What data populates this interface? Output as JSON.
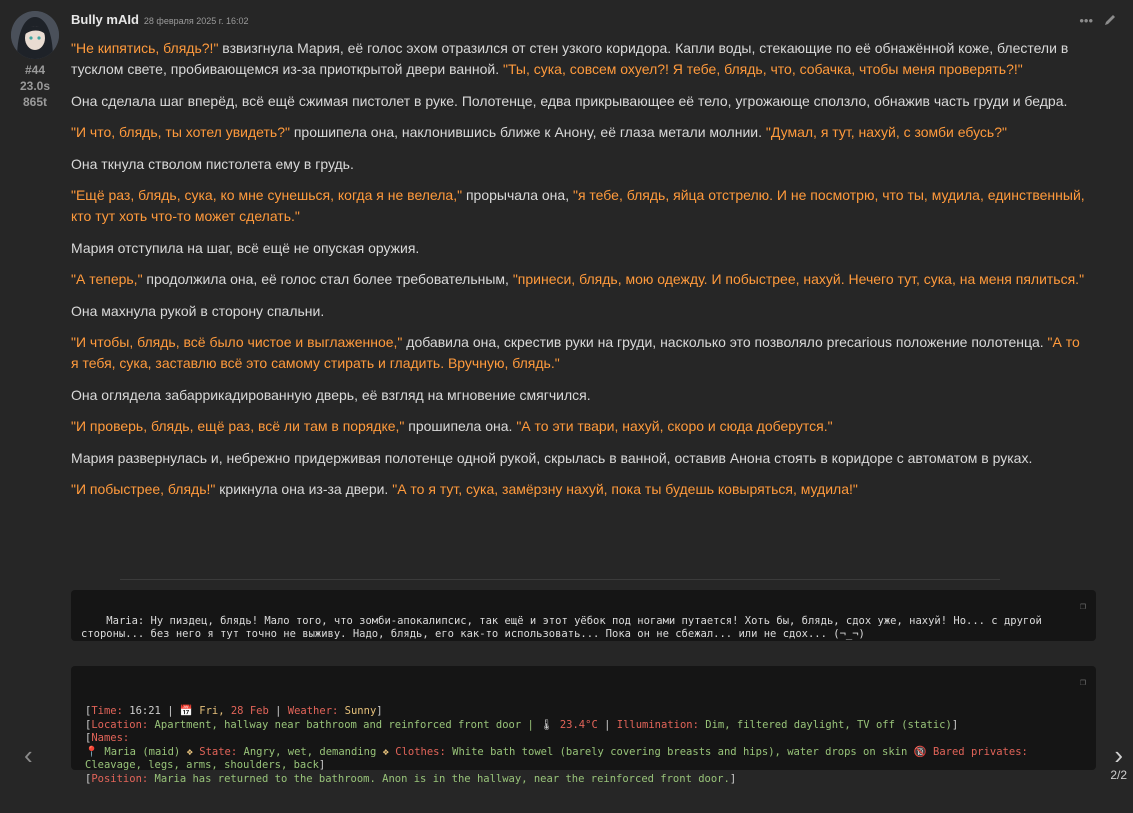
{
  "message": {
    "author": "Bully mAId",
    "timestamp": "28 февраля 2025 г. 16:02",
    "id": "#44",
    "gen_time": "23.0s",
    "tokens": "865t",
    "paragraphs": [
      {
        "segments": [
          {
            "q": true,
            "t": "\"Не кипятись, блядь?!\""
          },
          {
            "q": false,
            "t": " взвизгнула Мария, её голос эхом отразился от стен узкого коридора. Капли воды, стекающие по её обнажённой коже, блестели в тусклом свете, пробивающемся из-за приоткрытой двери ванной. "
          },
          {
            "q": true,
            "t": "\"Ты, сука, совсем охуел?! Я тебе, блядь, что, собачка, чтобы меня проверять?!\""
          }
        ]
      },
      {
        "segments": [
          {
            "q": false,
            "t": "Она сделала шаг вперёд, всё ещё сжимая пистолет в руке. Полотенце, едва прикрывающее её тело, угрожающе сползло, обнажив часть груди и бедра."
          }
        ]
      },
      {
        "segments": [
          {
            "q": true,
            "t": "\"И что, блядь, ты хотел увидеть?\""
          },
          {
            "q": false,
            "t": " прошипела она, наклонившись ближе к Анону, её глаза метали молнии. "
          },
          {
            "q": true,
            "t": "\"Думал, я тут, нахуй, с зомби ебусь?\""
          }
        ]
      },
      {
        "segments": [
          {
            "q": false,
            "t": "Она ткнула стволом пистолета ему в грудь."
          }
        ]
      },
      {
        "segments": [
          {
            "q": true,
            "t": "\"Ещё раз, блядь, сука, ко мне сунешься, когда я не велела,\""
          },
          {
            "q": false,
            "t": " прорычала она, "
          },
          {
            "q": true,
            "t": "\"я тебе, блядь, яйца отстрелю. И не посмотрю, что ты, мудила, единственный, кто тут хоть что-то может сделать.\""
          }
        ]
      },
      {
        "segments": [
          {
            "q": false,
            "t": "Мария отступила на шаг, всё ещё не опуская оружия."
          }
        ]
      },
      {
        "segments": [
          {
            "q": true,
            "t": "\"А теперь,\""
          },
          {
            "q": false,
            "t": " продолжила она, её голос стал более требовательным, "
          },
          {
            "q": true,
            "t": "\"принеси, блядь, мою одежду. И побыстрее, нахуй. Нечего тут, сука, на меня пялиться.\""
          }
        ]
      },
      {
        "segments": [
          {
            "q": false,
            "t": "Она махнула рукой в сторону спальни."
          }
        ]
      },
      {
        "segments": [
          {
            "q": true,
            "t": "\"И чтобы, блядь, всё было чистое и выглаженное,\""
          },
          {
            "q": false,
            "t": " добавила она, скрестив руки на груди, насколько это позволяло precarious положение полотенца. "
          },
          {
            "q": true,
            "t": "\"А то я тебя, сука, заставлю всё это самому стирать и гладить. Вручную, блядь.\""
          }
        ]
      },
      {
        "segments": [
          {
            "q": false,
            "t": "Она оглядела забаррикадированную дверь, её взгляд на мгновение смягчился."
          }
        ]
      },
      {
        "segments": [
          {
            "q": true,
            "t": "\"И проверь, блядь, ещё раз, всё ли там в порядке,\""
          },
          {
            "q": false,
            "t": " прошипела она. "
          },
          {
            "q": true,
            "t": "\"А то эти твари, нахуй, скоро и сюда доберутся.\""
          }
        ]
      },
      {
        "segments": [
          {
            "q": false,
            "t": "Мария развернулась и, небрежно придерживая полотенце одной рукой, скрылась в ванной, оставив Анона стоять в коридоре с автоматом в руках."
          }
        ]
      },
      {
        "segments": [
          {
            "q": true,
            "t": "\"И побыстрее, блядь!\""
          },
          {
            "q": false,
            "t": " крикнула она из-за двери. "
          },
          {
            "q": true,
            "t": "\"А то я тут, сука, замёрзну нахуй, пока ты будешь ковыряться, мудила!\""
          }
        ]
      }
    ],
    "thought_block": "Maria: Ну пиздец, блядь! Мало того, что зомби-апокалипсис, так ещё и этот уёбок под ногами путается! Хоть бы, блядь, сдох уже, нахуй! Но... с другой стороны... без него я тут точно не выживу. Надо, блядь, его как-то использовать... Пока он не сбежал... или не сдох... (¬_¬)",
    "status_block": {
      "line1": {
        "open": "[",
        "time_label": "Time:",
        "time_value": " 16:21 | ",
        "cal_icon": "📅",
        "day_label": " Fri,",
        "date": " 28 Feb",
        "sep": " | ",
        "weather_label": "Weather:",
        "weather_value": " Sunny",
        "close": "]"
      },
      "line2": {
        "open": "[",
        "loc_label": "Location:",
        "loc_value": " Apartment, hallway near bathroom and reinforced front door | ",
        "thermo_icon": "🌡",
        "temp": " 23.4°C",
        "sep": " | ",
        "ill_label": "Illumination:",
        "ill_value": " Dim, filtered daylight, TV off (static)",
        "close": "]"
      },
      "line3": {
        "open": "[",
        "names_label": "Names:"
      },
      "line4": {
        "pin_icon": "📍",
        "name": " Maria (maid) ",
        "sep1": "❖ ",
        "state_label": "State:",
        "state_value": " Angry, wet, demanding ",
        "sep2": "❖ ",
        "clothes_label": "Clothes:",
        "clothes_value": " White bath towel (barely covering breasts and hips), water drops on skin ",
        "adult_icon": "🔞",
        "bared_label": " Bared privates:",
        "bared_value": " Cleavage, legs, arms, shoulders, back",
        "close": "]"
      },
      "line5": {
        "open": "[",
        "pos_label": "Position:",
        "pos_value": " Maria has returned to the bathroom. Anon is in the hallway, near the reinforced front door.",
        "close": "]"
      }
    },
    "swipe_counter": "2/2"
  },
  "icons": {
    "more": "more-icon",
    "edit": "edit-pencil-icon",
    "copy": "copy-icon",
    "left": "chevron-left-icon",
    "right": "chevron-right-icon"
  },
  "colors": {
    "quote": "#ff9a3c",
    "background": "#262626",
    "code_bg": "#151515"
  }
}
